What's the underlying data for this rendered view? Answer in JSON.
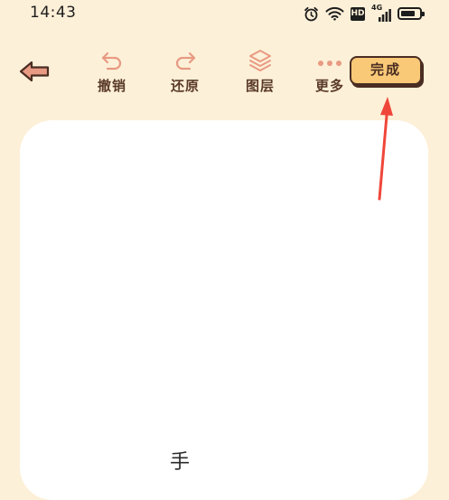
{
  "status_bar": {
    "time": "14:43",
    "hd_badge": "HD",
    "network_label": "4G",
    "icons": [
      "alarm-icon",
      "wifi-icon",
      "hd-icon",
      "signal-icon",
      "battery-icon"
    ],
    "battery_level": 0.8
  },
  "toolbar": {
    "back_icon": "back-arrow-icon",
    "undo_label": "撤销",
    "redo_label": "还原",
    "layers_label": "图层",
    "more_label": "更多",
    "done_label": "完成"
  },
  "canvas": {
    "partial_text": "手"
  },
  "colors": {
    "background": "#fdf0d8",
    "canvas": "#ffffff",
    "accent_icon": "#e89a83",
    "label_text": "#5a3a2a",
    "done_fill": "#f9c977",
    "done_border": "#4a2d22",
    "annotation_arrow": "#f0463a"
  }
}
